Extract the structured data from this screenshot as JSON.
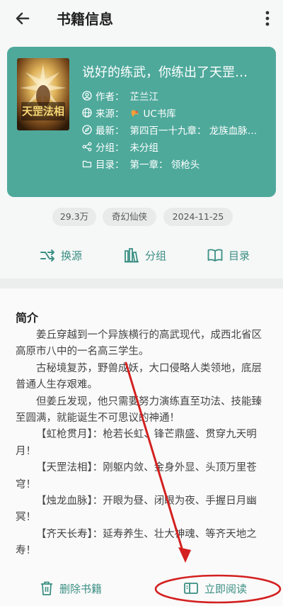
{
  "header": {
    "title": "书籍信息",
    "back_icon": "arrow-left-icon",
    "more_icon": "more-vertical-icon"
  },
  "book": {
    "title": "说好的练武，你练出了天罡…",
    "cover_title": "天罡法相",
    "cover_icon": "book-cover-image",
    "author_label": "作者：",
    "author": "芷兰江",
    "source_label": "来源：",
    "source": "UC书库",
    "latest_label": "最新：",
    "latest": "第四百一十九章：  龙族血脉…",
    "group_label": "分组：",
    "group": "未分组",
    "toc_label": "目录：",
    "toc": "第一章：  领枪头"
  },
  "tags": [
    "29.3万",
    "奇幻仙侠",
    "2024-11-25"
  ],
  "actions": {
    "change_source": "换源",
    "group": "分组",
    "toc": "目录"
  },
  "intro": {
    "heading": "简介",
    "paragraphs": [
      "姜丘穿越到一个异族横行的高武现代，成西北省区高原市八中的一名高三学生。",
      "古秘境复苏，野兽成妖，大口侵略人类领地，底层普通人生存艰难。",
      "但姜丘发现，他只需要努力演练直至功法、技能臻至圆满，就能诞生不可思议的神通！",
      "【虹枪贯月】：枪若长虹、锋芒鼎盛、贯穿九天明月！",
      "【天罡法相】：刚躯内敛、金身外显、头顶万里苍穹！",
      "【烛龙血脉】：开眼为昼、闭眼为夜、手握日月幽冥！",
      "【齐天长寿】：延寿养生、壮大神魂、等齐天地之寿！"
    ]
  },
  "bottom": {
    "delete": "删除书籍",
    "read": "立即阅读"
  },
  "colors": {
    "accent": "#3b8f84",
    "card": "#4ea99b",
    "annotation": "#d42020"
  }
}
